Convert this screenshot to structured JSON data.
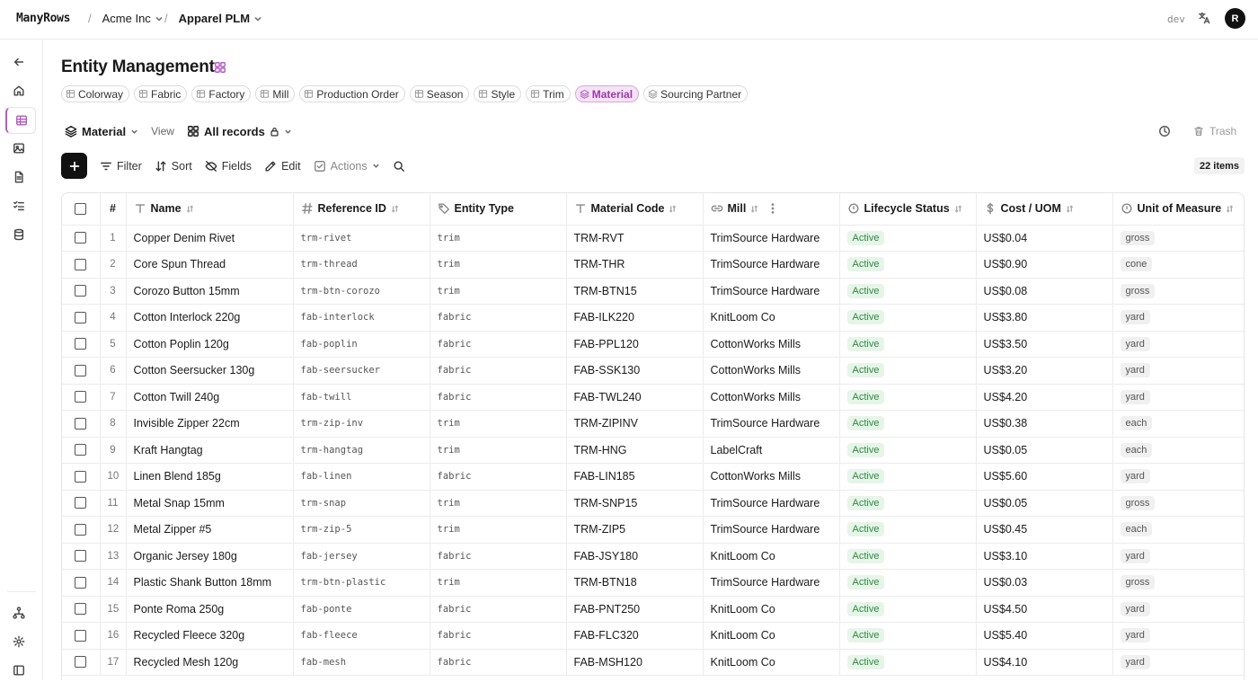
{
  "app": {
    "brand": "ManyRows",
    "env": "dev",
    "avatar_initial": "R"
  },
  "breadcrumb": [
    {
      "label": "Acme Inc",
      "sep": "/"
    },
    {
      "label": "Apparel PLM",
      "sep": "/"
    }
  ],
  "page": {
    "title": "Entity Management"
  },
  "entity_chips": [
    {
      "label": "Colorway",
      "active": false
    },
    {
      "label": "Fabric",
      "active": false
    },
    {
      "label": "Factory",
      "active": false
    },
    {
      "label": "Mill",
      "active": false
    },
    {
      "label": "Production Order",
      "active": false
    },
    {
      "label": "Season",
      "active": false
    },
    {
      "label": "Style",
      "active": false
    },
    {
      "label": "Trim",
      "active": false
    },
    {
      "label": "Material",
      "active": true
    },
    {
      "label": "Sourcing Partner",
      "active": false
    }
  ],
  "view_bar": {
    "entity": "Material",
    "view_label": "View",
    "records": "All records",
    "trash": "Trash"
  },
  "toolbar": {
    "filter": "Filter",
    "sort": "Sort",
    "fields": "Fields",
    "edit": "Edit",
    "actions": "Actions",
    "items_count": "22 items"
  },
  "table": {
    "columns": [
      {
        "label": "#"
      },
      {
        "label": "Name",
        "icon": "text-icon"
      },
      {
        "label": "Reference ID",
        "icon": "hash-icon"
      },
      {
        "label": "Entity Type",
        "icon": "tag-icon"
      },
      {
        "label": "Material Code",
        "icon": "text-icon"
      },
      {
        "label": "Mill",
        "icon": "link-icon"
      },
      {
        "label": "Lifecycle Status",
        "icon": "status-icon"
      },
      {
        "label": "Cost / UOM",
        "icon": "dollar-icon"
      },
      {
        "label": "Unit of Measure",
        "icon": "status-icon"
      }
    ],
    "rows": [
      {
        "n": "1",
        "name": "Copper Denim Rivet",
        "ref": "trm-rivet",
        "type": "trim",
        "code": "TRM-RVT",
        "mill": "TrimSource Hardware",
        "status": "Active",
        "cost": "US$0.04",
        "uom": "gross"
      },
      {
        "n": "2",
        "name": "Core Spun Thread",
        "ref": "trm-thread",
        "type": "trim",
        "code": "TRM-THR",
        "mill": "TrimSource Hardware",
        "status": "Active",
        "cost": "US$0.90",
        "uom": "cone"
      },
      {
        "n": "3",
        "name": "Corozo Button 15mm",
        "ref": "trm-btn-corozo",
        "type": "trim",
        "code": "TRM-BTN15",
        "mill": "TrimSource Hardware",
        "status": "Active",
        "cost": "US$0.08",
        "uom": "gross"
      },
      {
        "n": "4",
        "name": "Cotton Interlock 220g",
        "ref": "fab-interlock",
        "type": "fabric",
        "code": "FAB-ILK220",
        "mill": "KnitLoom Co",
        "status": "Active",
        "cost": "US$3.80",
        "uom": "yard"
      },
      {
        "n": "5",
        "name": "Cotton Poplin 120g",
        "ref": "fab-poplin",
        "type": "fabric",
        "code": "FAB-PPL120",
        "mill": "CottonWorks Mills",
        "status": "Active",
        "cost": "US$3.50",
        "uom": "yard"
      },
      {
        "n": "6",
        "name": "Cotton Seersucker 130g",
        "ref": "fab-seersucker",
        "type": "fabric",
        "code": "FAB-SSK130",
        "mill": "CottonWorks Mills",
        "status": "Active",
        "cost": "US$3.20",
        "uom": "yard"
      },
      {
        "n": "7",
        "name": "Cotton Twill 240g",
        "ref": "fab-twill",
        "type": "fabric",
        "code": "FAB-TWL240",
        "mill": "CottonWorks Mills",
        "status": "Active",
        "cost": "US$4.20",
        "uom": "yard"
      },
      {
        "n": "8",
        "name": "Invisible Zipper 22cm",
        "ref": "trm-zip-inv",
        "type": "trim",
        "code": "TRM-ZIPINV",
        "mill": "TrimSource Hardware",
        "status": "Active",
        "cost": "US$0.38",
        "uom": "each"
      },
      {
        "n": "9",
        "name": "Kraft Hangtag",
        "ref": "trm-hangtag",
        "type": "trim",
        "code": "TRM-HNG",
        "mill": "LabelCraft",
        "status": "Active",
        "cost": "US$0.05",
        "uom": "each"
      },
      {
        "n": "10",
        "name": "Linen Blend 185g",
        "ref": "fab-linen",
        "type": "fabric",
        "code": "FAB-LIN185",
        "mill": "CottonWorks Mills",
        "status": "Active",
        "cost": "US$5.60",
        "uom": "yard"
      },
      {
        "n": "11",
        "name": "Metal Snap 15mm",
        "ref": "trm-snap",
        "type": "trim",
        "code": "TRM-SNP15",
        "mill": "TrimSource Hardware",
        "status": "Active",
        "cost": "US$0.05",
        "uom": "gross"
      },
      {
        "n": "12",
        "name": "Metal Zipper #5",
        "ref": "trm-zip-5",
        "type": "trim",
        "code": "TRM-ZIP5",
        "mill": "TrimSource Hardware",
        "status": "Active",
        "cost": "US$0.45",
        "uom": "each"
      },
      {
        "n": "13",
        "name": "Organic Jersey 180g",
        "ref": "fab-jersey",
        "type": "fabric",
        "code": "FAB-JSY180",
        "mill": "KnitLoom Co",
        "status": "Active",
        "cost": "US$3.10",
        "uom": "yard"
      },
      {
        "n": "14",
        "name": "Plastic Shank Button 18mm",
        "ref": "trm-btn-plastic",
        "type": "trim",
        "code": "TRM-BTN18",
        "mill": "TrimSource Hardware",
        "status": "Active",
        "cost": "US$0.03",
        "uom": "gross"
      },
      {
        "n": "15",
        "name": "Ponte Roma 250g",
        "ref": "fab-ponte",
        "type": "fabric",
        "code": "FAB-PNT250",
        "mill": "KnitLoom Co",
        "status": "Active",
        "cost": "US$4.50",
        "uom": "yard"
      },
      {
        "n": "16",
        "name": "Recycled Fleece 320g",
        "ref": "fab-fleece",
        "type": "fabric",
        "code": "FAB-FLC320",
        "mill": "KnitLoom Co",
        "status": "Active",
        "cost": "US$5.40",
        "uom": "yard"
      },
      {
        "n": "17",
        "name": "Recycled Mesh 120g",
        "ref": "fab-mesh",
        "type": "fabric",
        "code": "FAB-MSH120",
        "mill": "KnitLoom Co",
        "status": "Active",
        "cost": "US$4.10",
        "uom": "yard"
      }
    ]
  }
}
